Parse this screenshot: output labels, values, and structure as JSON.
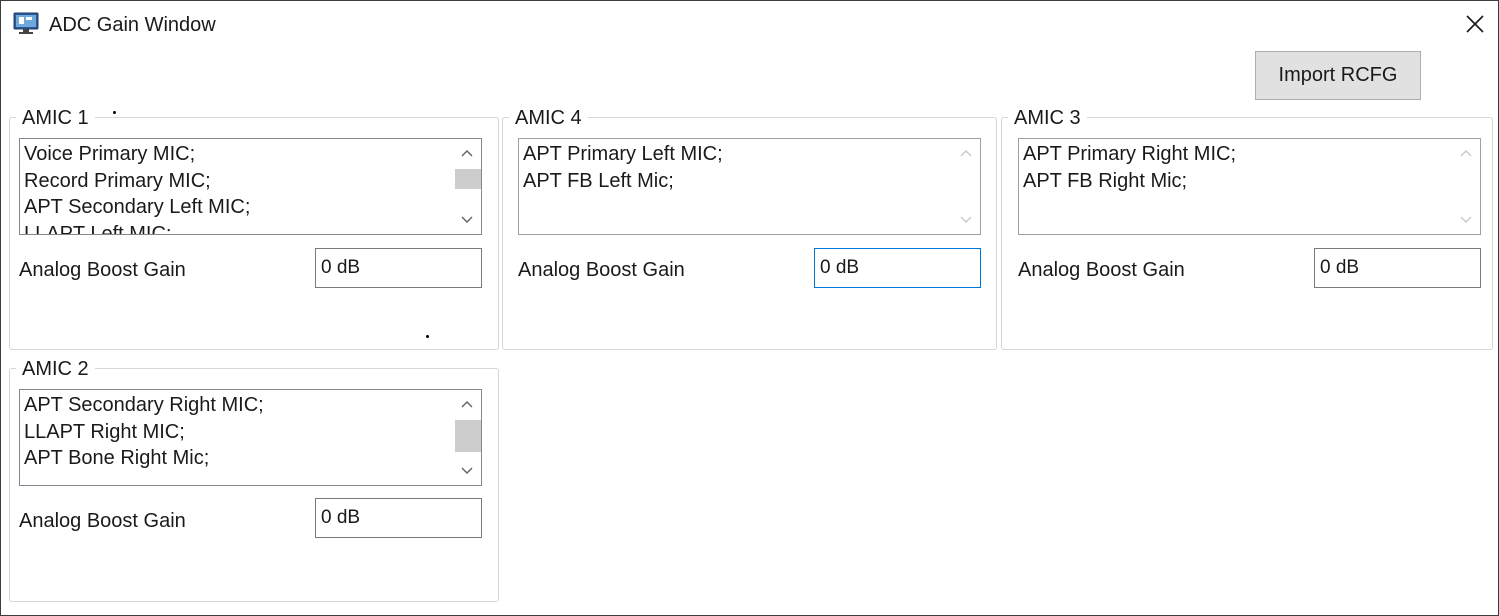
{
  "window": {
    "title": "ADC Gain Window",
    "icon": "app-monitor-icon",
    "close_icon": "close-icon"
  },
  "toolbar": {
    "import_label": "Import RCFG"
  },
  "groups": {
    "amic1": {
      "title": "AMIC 1",
      "items": [
        "Voice Primary MIC;",
        "Record Primary MIC;",
        "APT Secondary Left MIC;",
        "LLAPT Left MIC;"
      ],
      "gain_label": "Analog Boost Gain",
      "gain_value": "0 dB"
    },
    "amic4": {
      "title": "AMIC 4",
      "items": [
        "APT Primary Left MIC;",
        "APT FB Left Mic;"
      ],
      "gain_label": "Analog Boost Gain",
      "gain_value": "0 dB"
    },
    "amic3": {
      "title": "AMIC 3",
      "items": [
        "APT Primary Right MIC;",
        "APT FB Right Mic;"
      ],
      "gain_label": "Analog Boost Gain",
      "gain_value": "0 dB"
    },
    "amic2": {
      "title": "AMIC 2",
      "items": [
        "APT Secondary Right MIC;",
        "LLAPT Right MIC;",
        "APT Bone Right Mic;"
      ],
      "gain_label": "Analog Boost Gain",
      "gain_value": "0 dB"
    }
  },
  "colors": {
    "focus_border": "#0078d7",
    "button_bg": "#e1e1e1",
    "group_border": "#d6d6d6",
    "scroll_thumb": "#cdcdcd",
    "disabled_arrow": "#c8c8c8"
  }
}
